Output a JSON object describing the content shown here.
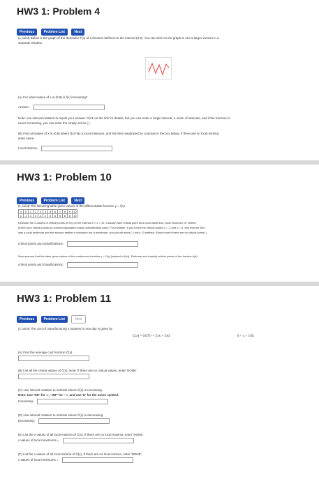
{
  "p1": {
    "title": "HW3 1: Problem 4",
    "buttons": {
      "prev": "Previous",
      "list": "Problem List",
      "next": "Next"
    },
    "intro_a": "(1 point) Below is the graph of the derivative f′(x) of a function defined on the interval (0,8). You can click on the graph to see a larger version in a",
    "intro_b": "separate window.",
    "qa": "(A) For what values of x in (0,8) is f(x) increasing?",
    "answer_label": "Answer:",
    "note_a": "Note: use interval notation to report your answer. Click on the link for details, but you can enter a single interval, a union of intervals, and if the function is",
    "note_b": "never increasing, you can enter the empty set as { }.",
    "qb": "(B) Find all values of x in (0,8) where f(x) has a local minimum, and list them separated by commas in the box below. If there are no local minima,",
    "qb2": "enter None.",
    "local_minima_label": "Local Minima:"
  },
  "p2": {
    "title": "HW3 1: Problem 10",
    "buttons": {
      "prev": "Previous",
      "list": "Problem List",
      "next": "Next"
    },
    "intro": "(1 point) The following table gives values of the differentiable function y = f(x).",
    "table_x": [
      "x",
      "0",
      "1",
      "2",
      "3",
      "4",
      "5",
      "6",
      "7",
      "8",
      "9",
      "10"
    ],
    "table_y": [
      "y",
      "-1",
      "3",
      "2",
      "-1",
      "1",
      "3",
      "4",
      "5",
      "6",
      "8",
      "10"
    ],
    "est_a": "Estimate the x-values of critical points of f(x) on the interval 0 < x < 10. Classify each critical point as a local maximum, local minimum, or neither.",
    "est_b": "(Enter your critical points as comma-separated xvalue,classification pairs. For example, if you found the critical points x = -2 and x = 3, and that the first",
    "est_c": "was a local minimum and the second neither a minimum nor a maximum, you should enter (-2,min), (3,neither). Enter none if there are no critical points.)",
    "cp_label": "critical points and classifications:",
    "assume": "Now assume that the table gives values of the continuous function y = f′(x) (instead of f(x)). Estimate and classify critical points of the function f(x).",
    "cp_label2": "critical points and classifications:"
  },
  "p3": {
    "title": "HW3 1: Problem 11",
    "buttons": {
      "prev": "Previous",
      "list": "Problem List",
      "next": "Next"
    },
    "intro": "(1 point) The cost of manufacturing x toasters in one day is given by",
    "equation": "C(x) = 0.07x² + 21x + 310,",
    "domain": "0 < x < 150.",
    "qa": "(A) Find the average cost function C̄(x).",
    "qb": "(B) List all the critical values of C̄(x). Note: If there are no critical values, enter 'NONE'.",
    "qc": "(C) Use interval notation to indicate where C̄(x) is increasing.",
    "qc_note": "Note: Use 'INF' for ∞, '-INF' for −∞, and use 'U' for the union symbol.",
    "qc_label": "Increasing:",
    "qd": "(D) Use interval notation to indicate where C̄(x) is decreasing.",
    "qd_label": "Decreasing:",
    "qe": "(E) List the x values of all local maxima of C̄(x). If there are no local maxima, enter 'NONE'.",
    "qe_label": "x values of local maximums =",
    "qf": "(F) List the x values of all local minima of C̄(x). If there are no local minima, enter 'NONE'.",
    "qf_label": "x values of local minimums ="
  }
}
